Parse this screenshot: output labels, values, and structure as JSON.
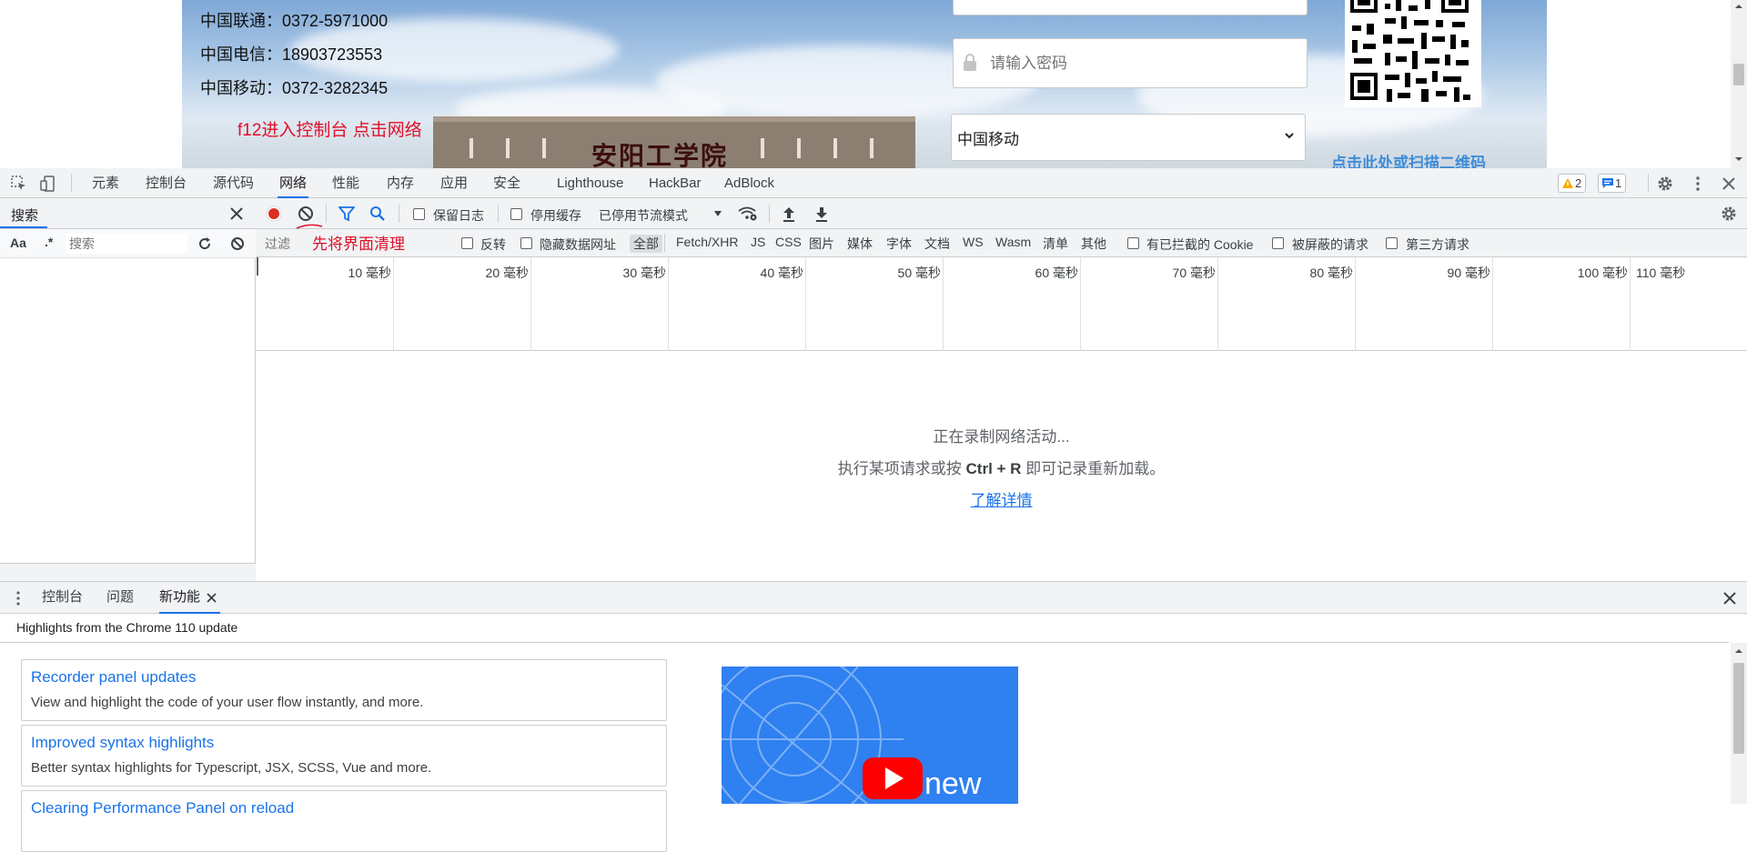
{
  "webpage": {
    "contacts": [
      "中国联通：0372-5971000",
      "中国电信：18903723553",
      "中国移动：0372-3282345"
    ],
    "annotation": "f12进入控制台 点击网络",
    "password_placeholder": "请输入密码",
    "carrier_selected": "中国移动",
    "qr_link": "点击此处或扫描二维码",
    "building_sign": "安阳工学院"
  },
  "devtools": {
    "tabs": [
      "元素",
      "控制台",
      "源代码",
      "网络",
      "性能",
      "内存",
      "应用",
      "安全",
      "Lighthouse",
      "HackBar",
      "AdBlock"
    ],
    "active_tab": "网络",
    "warnings_count": "2",
    "messages_count": "1",
    "search_panel": {
      "title": "搜索",
      "case_label": "Aa",
      "regex_label": ".*",
      "search_placeholder": "搜索"
    },
    "network": {
      "preserve_log": "保留日志",
      "disable_cache": "停用缓存",
      "throttling": "已停用节流模式",
      "filter_placeholder": "过滤",
      "annotation": "先将界面清理",
      "invert": "反转",
      "hide_data_urls": "隐藏数据网址",
      "types": [
        "全部",
        "Fetch/XHR",
        "JS",
        "CSS",
        "图片",
        "媒体",
        "字体",
        "文档",
        "WS",
        "Wasm",
        "清单",
        "其他"
      ],
      "blocked_cookies": "有已拦截的 Cookie",
      "blocked_requests": "被屏蔽的请求",
      "third_party": "第三方请求",
      "timeline_ticks": [
        "10 毫秒",
        "20 毫秒",
        "30 毫秒",
        "40 毫秒",
        "50 毫秒",
        "60 毫秒",
        "70 毫秒",
        "80 毫秒",
        "90 毫秒",
        "100 毫秒",
        "110 毫秒"
      ],
      "empty_line1": "正在录制网络活动...",
      "empty_line2_pre": "执行某项请求或按",
      "empty_line2_key": "Ctrl + R",
      "empty_line2_post": "即可记录重新加载。",
      "learn_more": "了解详情"
    },
    "drawer": {
      "tabs": [
        "控制台",
        "问题",
        "新功能"
      ],
      "active_tab": "新功能",
      "header": "Highlights from the Chrome 110 update",
      "cards": [
        {
          "title": "Recorder panel updates",
          "desc": "View and highlight the code of your user flow instantly, and more."
        },
        {
          "title": "Improved syntax highlights",
          "desc": "Better syntax highlights for Typescript, JSX, SCSS, Vue and more."
        },
        {
          "title": "Clearing Performance Panel on reload",
          "desc": ""
        }
      ],
      "promo_text": "new"
    }
  }
}
